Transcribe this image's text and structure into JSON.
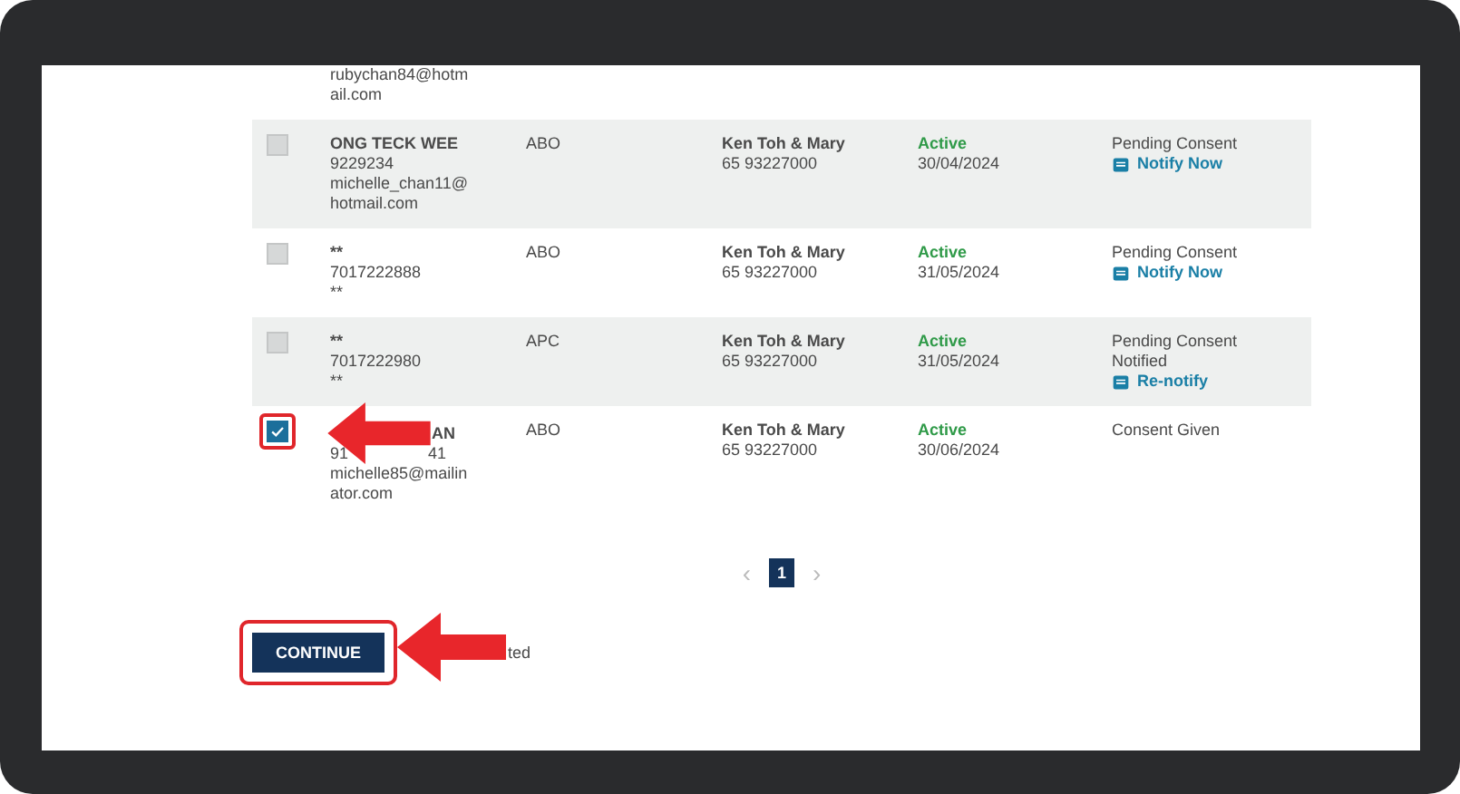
{
  "rows": [
    {
      "kind": "partial",
      "name": "",
      "contact": [
        [
          "rubychan84@hotm"
        ],
        [
          "ail.com"
        ]
      ]
    },
    {
      "kind": "plain",
      "checked": false,
      "name": "ONG TECK WEE",
      "contact": [
        [
          "9229234"
        ],
        [
          "michelle_chan11@"
        ],
        [
          "hotmail.com"
        ]
      ],
      "type": "ABO",
      "agent": "Ken Toh & Mary",
      "agent_phone": "65 93227000",
      "status": "Active",
      "date": "30/04/2024",
      "consent": [
        "Pending Consent"
      ],
      "action": "Notify Now"
    },
    {
      "kind": "plain",
      "checked": false,
      "name": "**",
      "contact": [
        [
          "7017222888"
        ],
        [
          "**"
        ]
      ],
      "type": "ABO",
      "agent": "Ken Toh & Mary",
      "agent_phone": "65 93227000",
      "status": "Active",
      "date": "31/05/2024",
      "consent": [
        "Pending Consent"
      ],
      "action": "Notify Now"
    },
    {
      "kind": "plain",
      "checked": false,
      "name": "**",
      "contact": [
        [
          "7017222980"
        ],
        [
          "**"
        ]
      ],
      "type": "APC",
      "agent": "Ken Toh & Mary",
      "agent_phone": "65 93227000",
      "status": "Active",
      "date": "31/05/2024",
      "consent": [
        "Pending Consent",
        "Notified"
      ],
      "action": "Re-notify"
    },
    {
      "kind": "under_pointer",
      "checked": true,
      "name": "AN",
      "contact": [
        [
          "91",
          "41"
        ],
        [
          "michelle85@mailin"
        ],
        [
          "ator.com"
        ]
      ],
      "type": "ABO",
      "agent": "Ken Toh & Mary",
      "agent_phone": "65 93227000",
      "status": "Active",
      "date": "30/06/2024",
      "consent": [
        "Consent Given"
      ]
    }
  ],
  "pagination": {
    "prev": "‹",
    "pages": [
      {
        "label": "1",
        "selected": true
      }
    ],
    "next": "›"
  },
  "continue_button": "CONTINUE",
  "selection_note": "ted"
}
